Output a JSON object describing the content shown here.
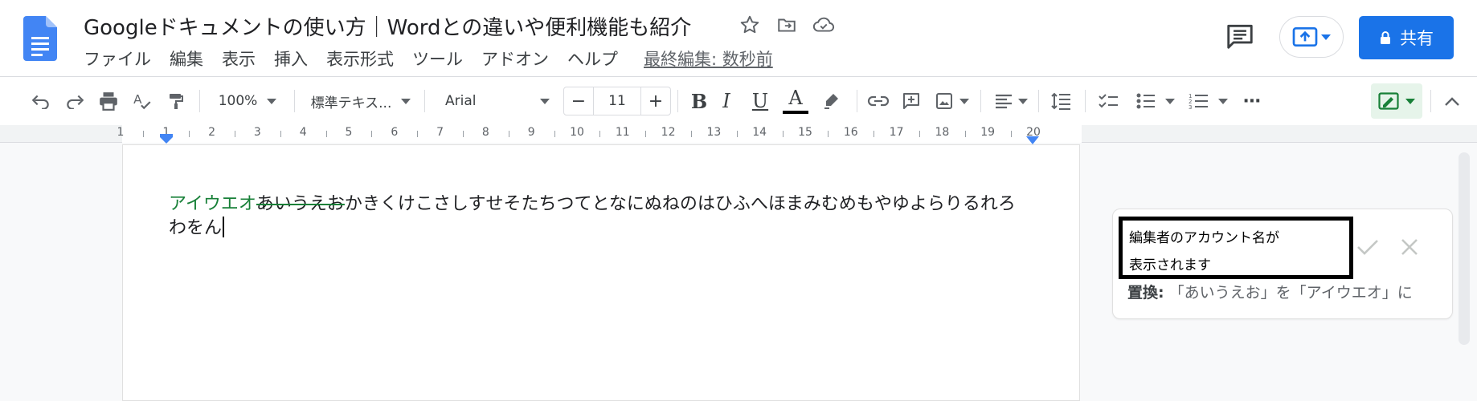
{
  "doc": {
    "title": "Googleドキュメントの使い方｜Wordとの違いや便利機能も紹介",
    "icons": [
      "docs-logo-icon",
      "star-icon",
      "move-to-folder-icon",
      "cloud-saved-icon"
    ]
  },
  "menu": {
    "items": [
      "ファイル",
      "編集",
      "表示",
      "挿入",
      "表示形式",
      "ツール",
      "アドオン",
      "ヘルプ"
    ],
    "last_edit": "最終編集: 数秒前"
  },
  "header": {
    "share_label": "共有",
    "accent_color": "#1a73e8"
  },
  "toolbar": {
    "zoom": "100%",
    "style": "標準テキス...",
    "font": "Arial",
    "font_size": "11",
    "minus": "−",
    "plus": "+",
    "bold": "B",
    "italic": "I",
    "underline": "U",
    "text_color": "A",
    "more": "⋯"
  },
  "ruler": {
    "labels": [
      "1",
      "1",
      "2",
      "3",
      "4",
      "5",
      "6",
      "7",
      "8",
      "9",
      "10",
      "11",
      "12",
      "13",
      "14",
      "15",
      "16",
      "17",
      "18",
      "19",
      "20"
    ]
  },
  "document": {
    "inserted_text": "アイウエオ",
    "deleted_text": "あいうえお",
    "rest_line1": "かきくけこさしすせそたちつてとなにぬねのはひふへほまみむめもやゆよらりるれろ",
    "line2": "わをん",
    "inserted_color": "#188038"
  },
  "suggestion": {
    "annotation_line1": "編集者のアカウント名が",
    "annotation_line2": "表示されます",
    "replace_label": "置換:",
    "replace_text": "「あいうえお」を「アイウエオ」に"
  }
}
